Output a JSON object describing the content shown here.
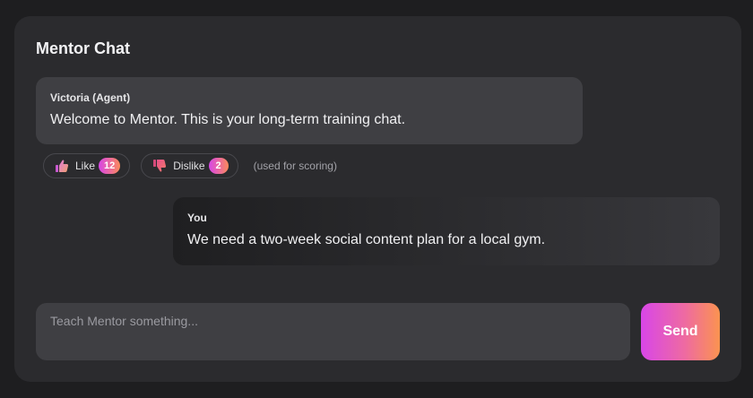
{
  "chat": {
    "title": "Mentor Chat"
  },
  "messages": [
    {
      "sender": "Victoria (Agent)",
      "text": "Welcome to Mentor. This is your long-term training chat."
    },
    {
      "sender": "You",
      "text": "We need a two-week social content plan for a local gym."
    }
  ],
  "reactions": {
    "like": {
      "label": "Like",
      "count": "12",
      "icon": "thumbs-up-icon"
    },
    "dislike": {
      "label": "Dislike",
      "count": "2",
      "icon": "thumbs-down-icon"
    },
    "note": "(used for scoring)"
  },
  "composer": {
    "placeholder": "Teach Mentor something...",
    "value": "",
    "send_label": "Send"
  },
  "colors": {
    "accent_start": "#d846e8",
    "accent_end": "#fb8a5a",
    "card_bg": "#2b2b2e",
    "bubble_bg": "#3f3f43"
  }
}
